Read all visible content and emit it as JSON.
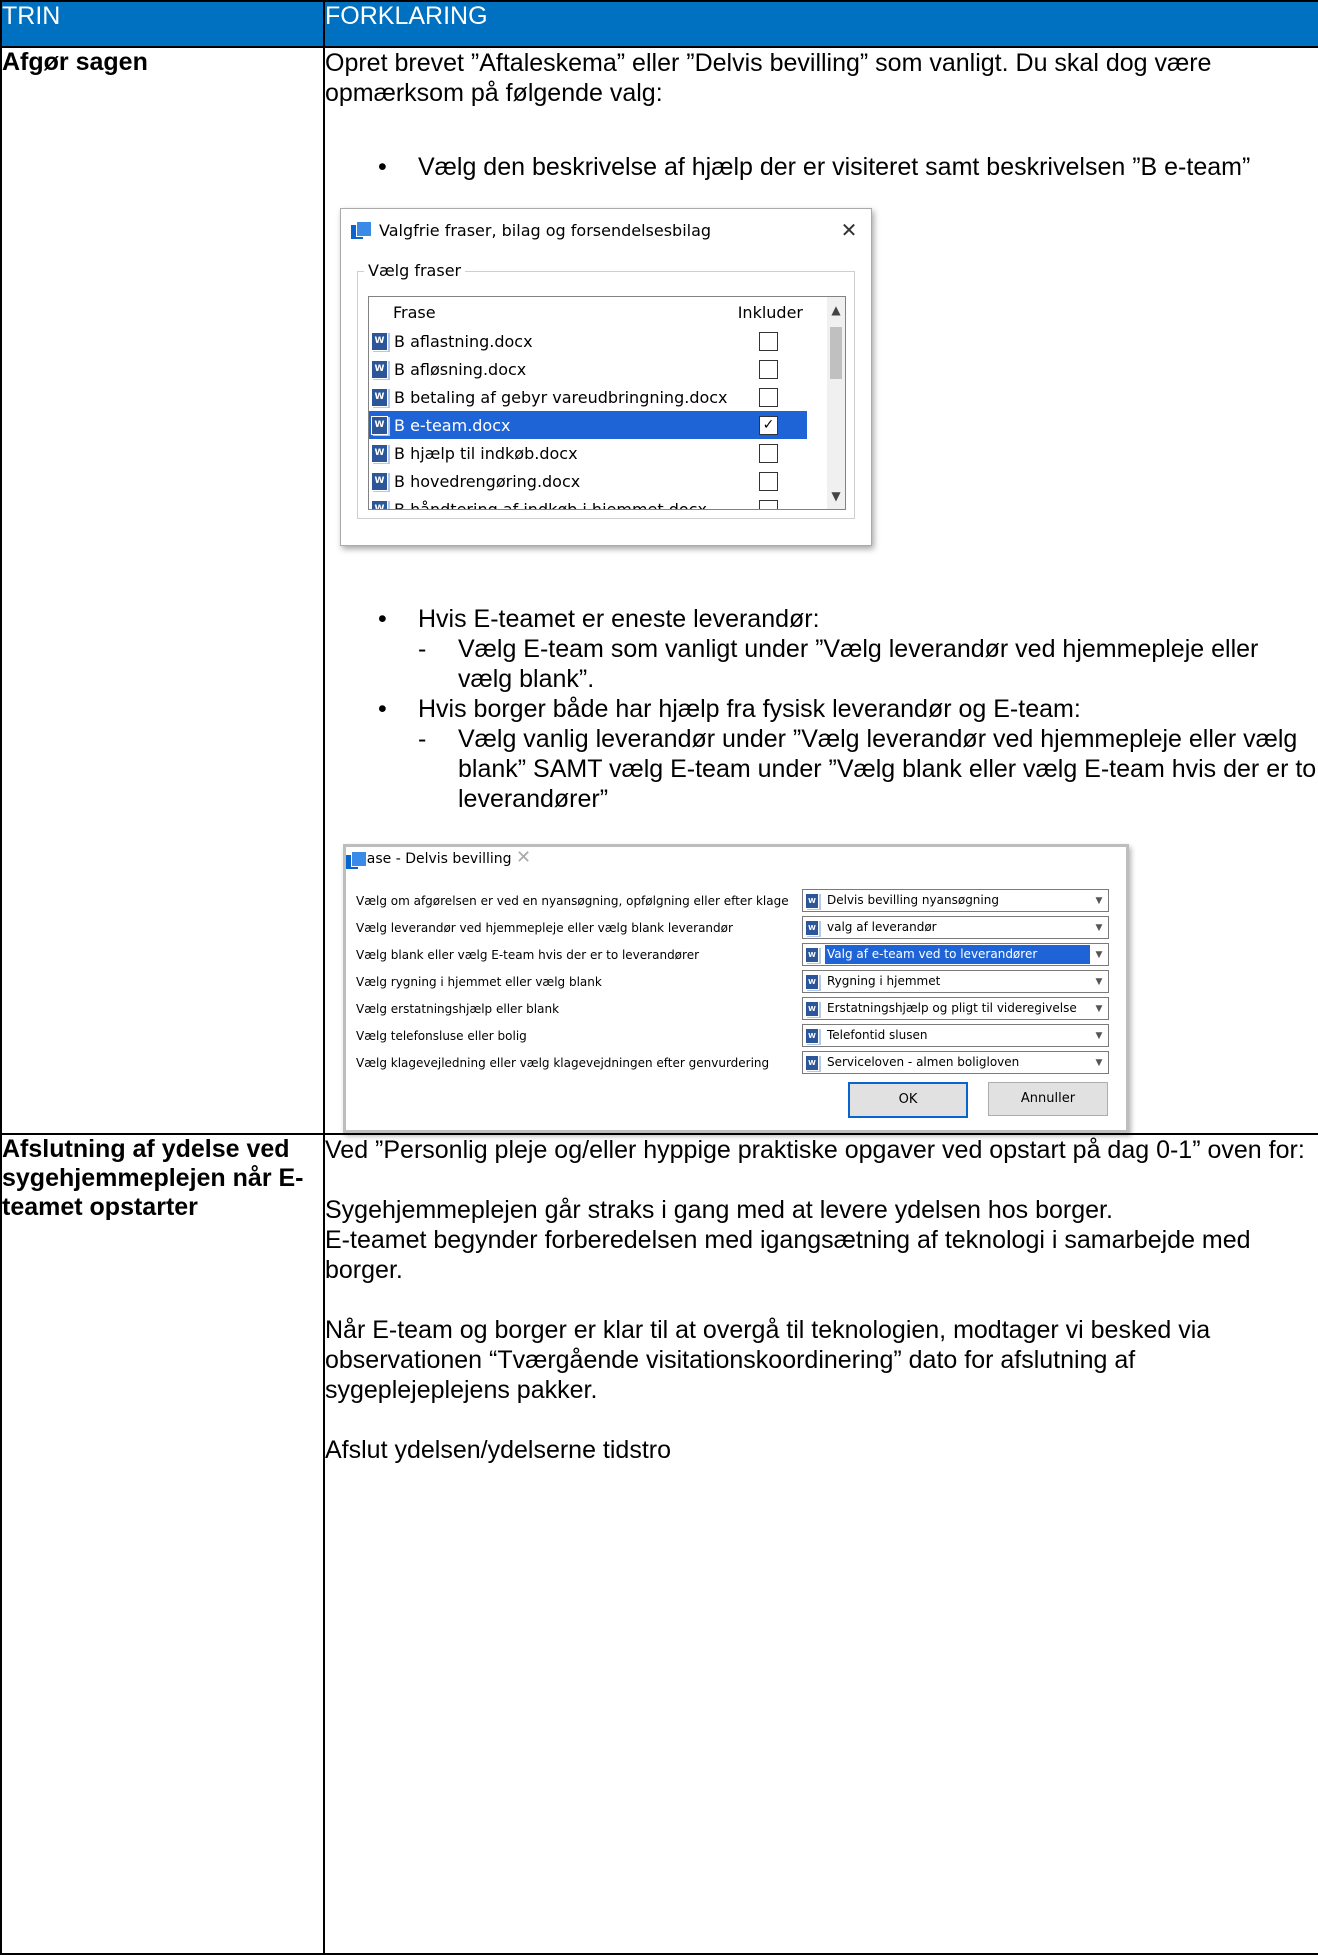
{
  "table": {
    "headers": [
      "TRIN",
      "FORKLARING"
    ],
    "row1": {
      "trin": "Afgør sagen",
      "intro": "Opret brevet ”Aftaleskema” eller ”Delvis bevilling” som vanligt. Du skal dog være opmærksom på følgende valg:",
      "bullet1": "Vælg den beskrivelse af hjælp der er visiteret samt beskrivelsen ”B e-team”",
      "bullet2": "Hvis E-teamet er eneste leverandør:",
      "bullet2_dash": "Vælg E-team som vanligt under ”Vælg leverandør ved hjemmepleje eller vælg blank”.",
      "bullet3": "Hvis borger både har hjælp fra fysisk leverandør og E-team:",
      "bullet3_dash": "Vælg vanlig leverandør under ”Vælg leverandør ved hjemmepleje eller vælg blank” SAMT vælg E-team under ”Vælg blank eller vælg E-team hvis der er to leverandører”"
    },
    "row2": {
      "trin": "Afslutning af ydelse ved sygehjemmeplejen når E-teamet opstarter",
      "p1": "Ved ”Personlig pleje og/eller hyppige praktiske opgaver ved opstart på dag 0-1” oven for:",
      "p2": "Sygehjemmeplejen går straks i gang med at levere ydelsen hos borger.",
      "p3": "E-teamet begynder forberedelsen med igangsætning af teknologi i samarbejde med borger.",
      "p4": "Når E-team og borger er klar til at overgå til teknologien, modtager vi besked via observationen “Tværgående visitationskoordinering” dato for afslutning af sygeplejeplejens pakker.",
      "p5": "Afslut ydelsen/ydelserne tidstro"
    }
  },
  "dialog1": {
    "title": "Valgfrie fraser, bilag og forsendelsesbilag",
    "group_label": "Vælg fraser",
    "col_frase": "Frase",
    "col_inkluder": "Inkluder",
    "rows": [
      {
        "name": "B aflastning.docx",
        "checked": false
      },
      {
        "name": "B afløsning.docx",
        "checked": false
      },
      {
        "name": "B betaling af gebyr vareudbringning.docx",
        "checked": false
      },
      {
        "name": "B e-team.docx",
        "checked": true,
        "selected": true
      },
      {
        "name": "B hjælp til indkøb.docx",
        "checked": false
      },
      {
        "name": "B hovedrengøring.docx",
        "checked": false
      },
      {
        "name": "B håndtering af indkøb i hjemmet.docx",
        "checked": false
      }
    ]
  },
  "dialog2": {
    "title": "Frase - Delvis bevilling",
    "rows": [
      {
        "label": "Vælg om afgørelsen er ved en nyansøgning, opfølgning eller efter klage",
        "value": "Delvis bevilling nyansøgning"
      },
      {
        "label": "Vælg leverandør ved hjemmepleje eller vælg blank leverandør",
        "value": "valg af leverandør"
      },
      {
        "label": "Vælg blank eller vælg E-team hvis der er to leverandører",
        "value": "Valg af e-team ved to leverandører",
        "selected": true
      },
      {
        "label": "Vælg rygning i hjemmet eller vælg blank",
        "value": "Rygning i hjemmet"
      },
      {
        "label": "Vælg erstatningshjælp eller blank",
        "value": "Erstatningshjælp og pligt til videregivelse"
      },
      {
        "label": "Vælg  telefonsluse eller bolig",
        "value": "Telefontid slusen"
      },
      {
        "label": "Vælg klagevejledning eller vælg klagevejdningen efter genvurdering",
        "value": "Serviceloven - almen boligloven"
      }
    ],
    "ok_label": "OK",
    "cancel_label": "Annuller"
  },
  "icons": {
    "word_doc": "word-document-icon",
    "app": "app-window-icon",
    "close": "close-icon",
    "dropdown": "chevron-down-icon"
  },
  "colors": {
    "header_bg": "#0070c0",
    "selection": "#1f64d6"
  }
}
